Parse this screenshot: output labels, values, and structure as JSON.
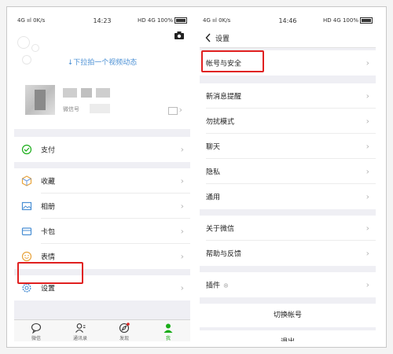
{
  "phone_left": {
    "status": {
      "network": "4G ııl 0K/s",
      "time": "14:23",
      "right": "HD 4G 100%"
    },
    "header": {
      "hint": "↓下拉拍一个视频动态",
      "wechat_id_label": "微信号"
    },
    "menu": [
      {
        "label": "支付",
        "icon": "payment-icon"
      },
      {
        "label": "收藏",
        "icon": "favorites-icon"
      },
      {
        "label": "相册",
        "icon": "album-icon"
      },
      {
        "label": "卡包",
        "icon": "card-icon"
      },
      {
        "label": "表情",
        "icon": "sticker-icon"
      },
      {
        "label": "设置",
        "icon": "settings-icon"
      }
    ],
    "tabs": [
      {
        "label": "微信",
        "icon": "chat-icon"
      },
      {
        "label": "通讯录",
        "icon": "contacts-icon"
      },
      {
        "label": "发现",
        "icon": "discover-icon"
      },
      {
        "label": "我",
        "icon": "me-icon"
      }
    ]
  },
  "phone_right": {
    "status": {
      "network": "4G ııl 0K/s",
      "time": "14:46",
      "right": "HD 4G 100%"
    },
    "nav": {
      "title": "设置"
    },
    "rows": [
      "帐号与安全",
      "新消息提醒",
      "勿扰模式",
      "聊天",
      "隐私",
      "通用",
      "关于微信",
      "帮助与反馈",
      "插件"
    ],
    "switch_account": "切换帐号",
    "logout": "退出"
  },
  "colors": {
    "accent": "#1aad19",
    "highlight": "#e02020",
    "hint": "#4a8fd4"
  }
}
